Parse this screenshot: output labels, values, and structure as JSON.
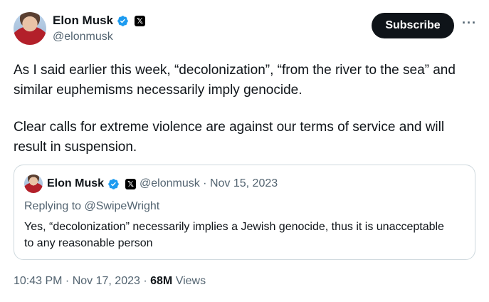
{
  "author": {
    "name": "Elon Musk",
    "handle": "@elonmusk",
    "verified_icon": "verified-badge-icon",
    "affiliate_icon": "x-logo-icon"
  },
  "actions": {
    "subscribe_label": "Subscribe",
    "more_label": "···"
  },
  "tweet": {
    "paragraphs": [
      "As I said earlier this week, “decolonization”, “from the river to the sea” and similar euphemisms necessarily imply genocide.",
      "Clear calls for extreme violence are against our terms of service and will result in suspension."
    ]
  },
  "quote": {
    "name": "Elon Musk",
    "handle_date": "@elonmusk · Nov 15, 2023",
    "replying": "Replying to @SwipeWright",
    "text": "Yes, “decolonization” necessarily implies a Jewish genocide, thus it is unacceptable to any reasonable person"
  },
  "meta": {
    "time": "10:43 PM · Nov 17, 2023 ·",
    "views_count": "68M",
    "views_label": "Views"
  },
  "colors": {
    "text": "#0f1419",
    "secondary": "#536471",
    "verified": "#1d9bf0",
    "border": "#cfd9de"
  }
}
